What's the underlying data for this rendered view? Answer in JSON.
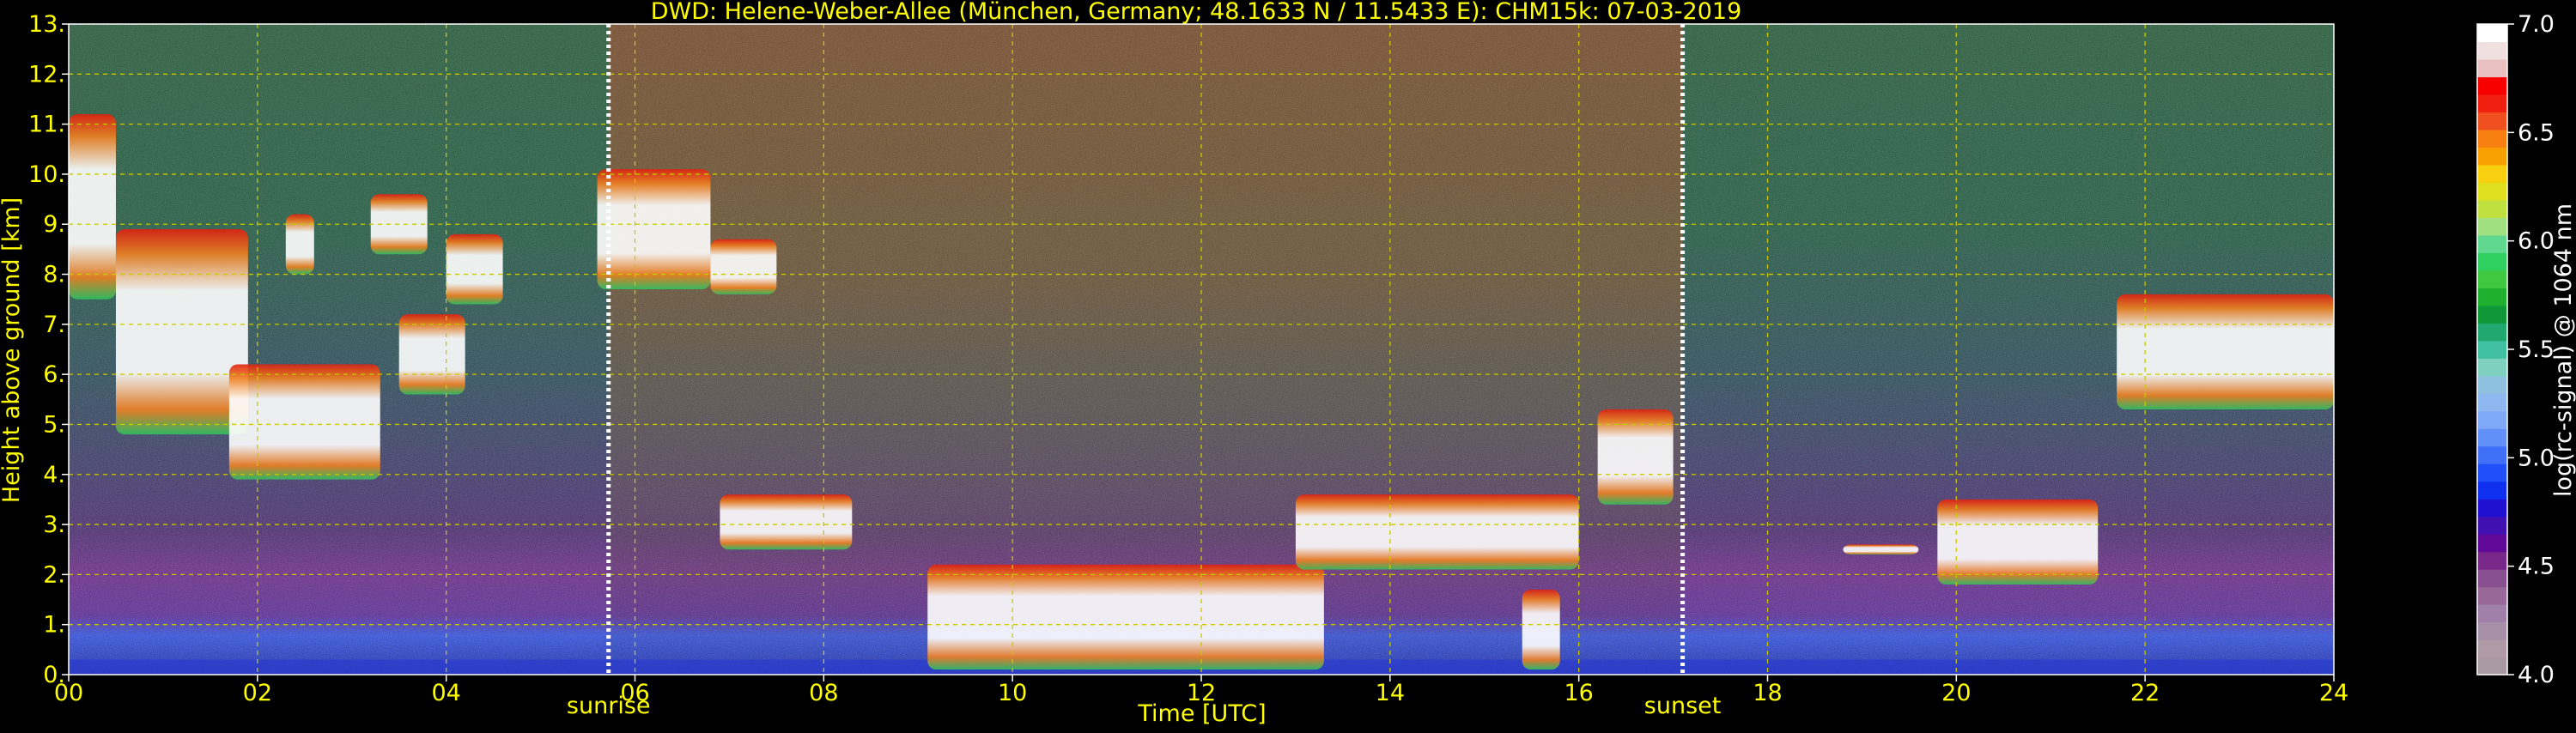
{
  "chart_data": {
    "type": "heatmap",
    "title": "DWD: Helene-Weber-Allee (München, Germany; 48.1633 N / 11.5433 E):    CHM15k: 07-03-2019",
    "xlabel": "Time [UTC]",
    "ylabel": "Height above ground [km]",
    "xlim": [
      0,
      24
    ],
    "ylim": [
      0,
      13
    ],
    "x_ticks": [
      "00",
      "02",
      "04",
      "06",
      "08",
      "10",
      "12",
      "14",
      "16",
      "18",
      "20",
      "22",
      "24"
    ],
    "y_ticks": [
      "0.",
      "1.",
      "2.",
      "3.",
      "4.",
      "5.",
      "6.",
      "7.",
      "8.",
      "9.",
      "10.",
      "11.",
      "12.",
      "13."
    ],
    "grid": true,
    "colors": {
      "text": "#ffff00",
      "grid": "#c8c800",
      "background": "#000000",
      "sun_lines": "#ffffff"
    },
    "annotations": [
      {
        "label": "sunrise",
        "x": 5.72
      },
      {
        "label": "sunset",
        "x": 17.1
      }
    ],
    "colorbar": {
      "label": "log(rc-signal) @ 1064 nm",
      "range": [
        4.0,
        7.0
      ],
      "ticks": [
        "4.0",
        "4.5",
        "5.0",
        "5.5",
        "6.0",
        "6.5",
        "7.0"
      ],
      "colors": [
        "#a89aa0",
        "#b09aa8",
        "#a890a8",
        "#a080a8",
        "#986898",
        "#885090",
        "#782888",
        "#600898",
        "#4010b0",
        "#2010d0",
        "#1030f0",
        "#2050f8",
        "#4070f8",
        "#6090f8",
        "#80a8f8",
        "#90b8f0",
        "#90c0e0",
        "#80d0c0",
        "#40c0a0",
        "#20a870",
        "#109838",
        "#20b030",
        "#40c840",
        "#30d060",
        "#60d890",
        "#a0e080",
        "#c0e040",
        "#e0e020",
        "#f8d010",
        "#f8a000",
        "#f88010",
        "#f05020",
        "#f02010",
        "#f80000",
        "#e8c0c0",
        "#f0e0e0",
        "#ffffff"
      ]
    },
    "cloud_layers": [
      {
        "t": [
          0.0,
          0.5
        ],
        "h": [
          7.5,
          11.2
        ]
      },
      {
        "t": [
          0.5,
          1.9
        ],
        "h": [
          4.8,
          8.9
        ]
      },
      {
        "t": [
          1.7,
          3.3
        ],
        "h": [
          3.9,
          6.2
        ]
      },
      {
        "t": [
          2.3,
          2.6
        ],
        "h": [
          8.0,
          9.2
        ]
      },
      {
        "t": [
          3.2,
          3.8
        ],
        "h": [
          8.4,
          9.6
        ]
      },
      {
        "t": [
          3.5,
          4.2
        ],
        "h": [
          5.6,
          7.2
        ]
      },
      {
        "t": [
          4.0,
          4.6
        ],
        "h": [
          7.4,
          8.8
        ]
      },
      {
        "t": [
          5.6,
          6.8
        ],
        "h": [
          7.7,
          10.1
        ]
      },
      {
        "t": [
          6.8,
          7.5
        ],
        "h": [
          7.6,
          8.7
        ]
      },
      {
        "t": [
          6.9,
          8.3
        ],
        "h": [
          2.5,
          3.6
        ]
      },
      {
        "t": [
          9.1,
          13.3
        ],
        "h": [
          0.1,
          2.2
        ]
      },
      {
        "t": [
          13.0,
          16.0
        ],
        "h": [
          2.1,
          3.6
        ]
      },
      {
        "t": [
          15.4,
          15.8
        ],
        "h": [
          0.1,
          1.7
        ]
      },
      {
        "t": [
          16.2,
          17.0
        ],
        "h": [
          3.4,
          5.3
        ]
      },
      {
        "t": [
          18.8,
          19.6
        ],
        "h": [
          2.4,
          2.6
        ]
      },
      {
        "t": [
          19.8,
          21.5
        ],
        "h": [
          1.8,
          3.5
        ]
      },
      {
        "t": [
          21.7,
          24.0
        ],
        "h": [
          5.3,
          7.6
        ]
      }
    ]
  }
}
